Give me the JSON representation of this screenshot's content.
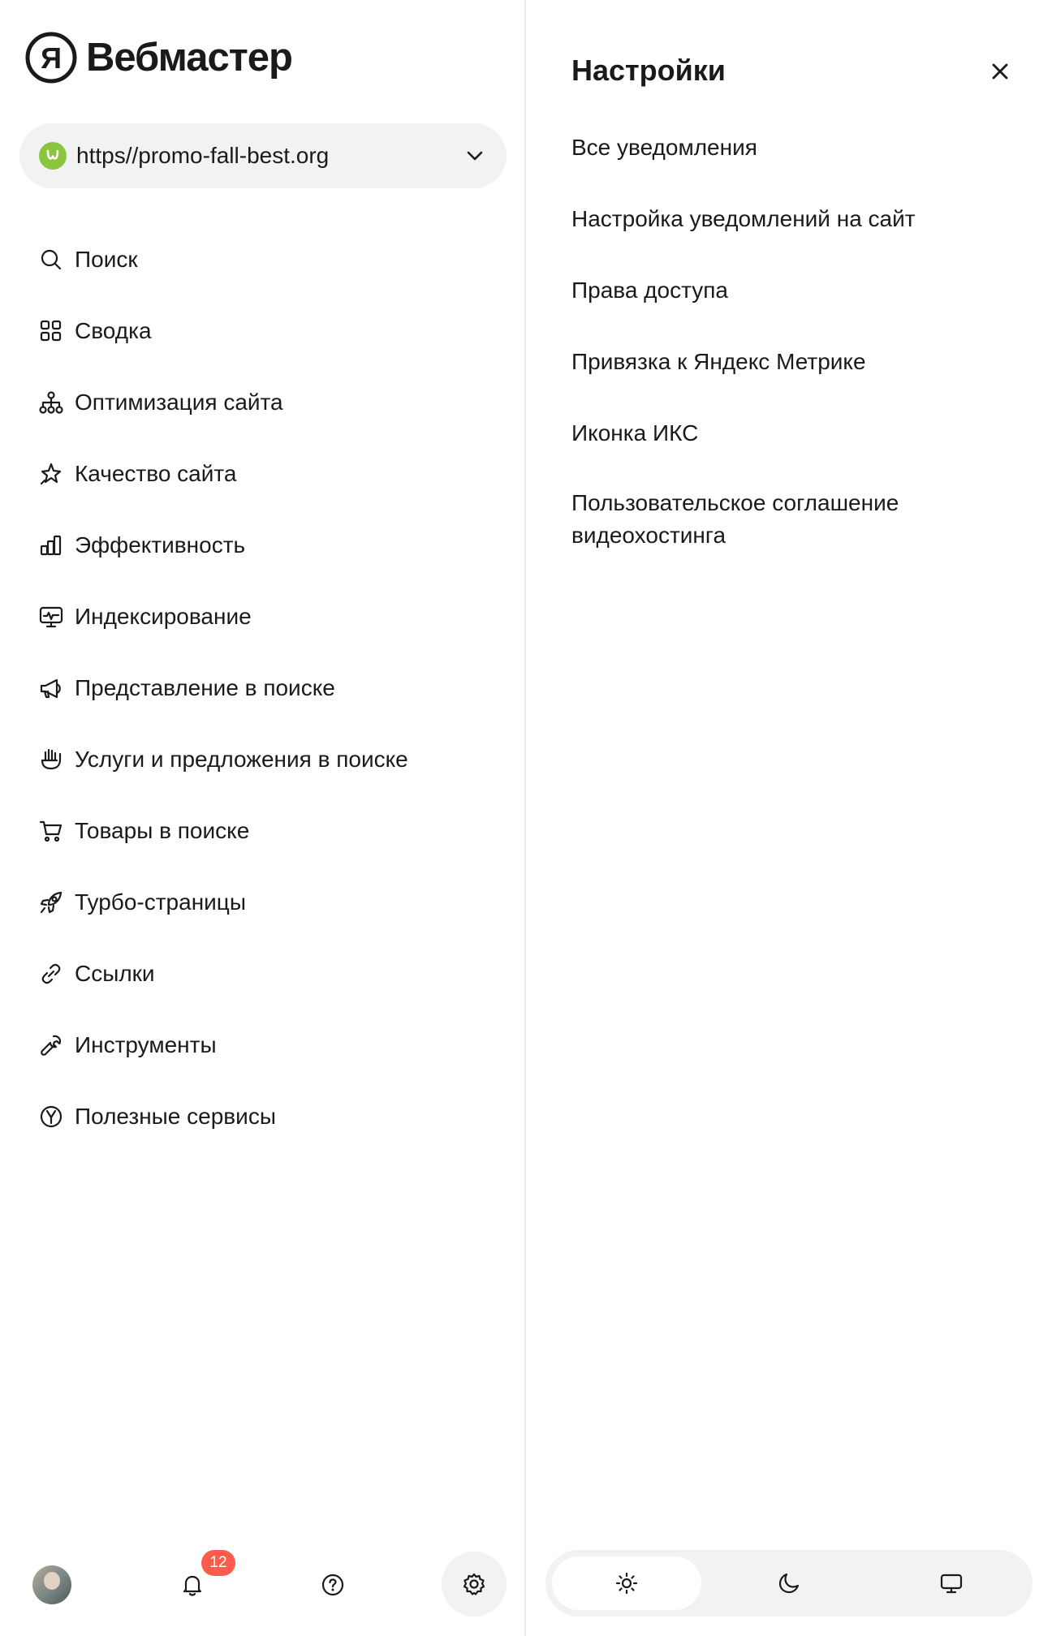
{
  "app": {
    "brand_name": "Вебмастер",
    "logo_letter": "Я"
  },
  "site_selector": {
    "url": "https//promo-fall-best.org",
    "favicon_color": "#8bc53f"
  },
  "nav": {
    "items": [
      {
        "label": "Поиск",
        "icon": "search-icon"
      },
      {
        "label": "Сводка",
        "icon": "grid-icon"
      },
      {
        "label": "Оптимизация сайта",
        "icon": "sitemap-icon"
      },
      {
        "label": "Качество сайта",
        "icon": "sparkle-star-icon"
      },
      {
        "label": "Эффективность",
        "icon": "bar-chart-icon"
      },
      {
        "label": "Индексирование",
        "icon": "monitor-pulse-icon"
      },
      {
        "label": "Представление в поиске",
        "icon": "megaphone-icon"
      },
      {
        "label": "Услуги и предложения в поиске",
        "icon": "hand-offer-icon"
      },
      {
        "label": "Товары в поиске",
        "icon": "cart-icon"
      },
      {
        "label": "Турбо-страницы",
        "icon": "rocket-icon"
      },
      {
        "label": "Ссылки",
        "icon": "link-icon"
      },
      {
        "label": "Инструменты",
        "icon": "wrench-icon"
      },
      {
        "label": "Полезные сервисы",
        "icon": "yandex-circle-icon"
      }
    ]
  },
  "bottom_bar": {
    "notifications_count": "12",
    "badge_color": "#ff5c4d"
  },
  "settings_panel": {
    "title": "Настройки",
    "items": [
      "Все уведомления",
      "Настройка уведомлений на сайт",
      "Права доступа",
      "Привязка к Яндекс Метрике",
      "Иконка ИКС",
      "Пользовательское соглашение видеохостинга"
    ]
  },
  "theme_switch": {
    "options": [
      "light",
      "dark",
      "system"
    ],
    "selected": "light"
  }
}
